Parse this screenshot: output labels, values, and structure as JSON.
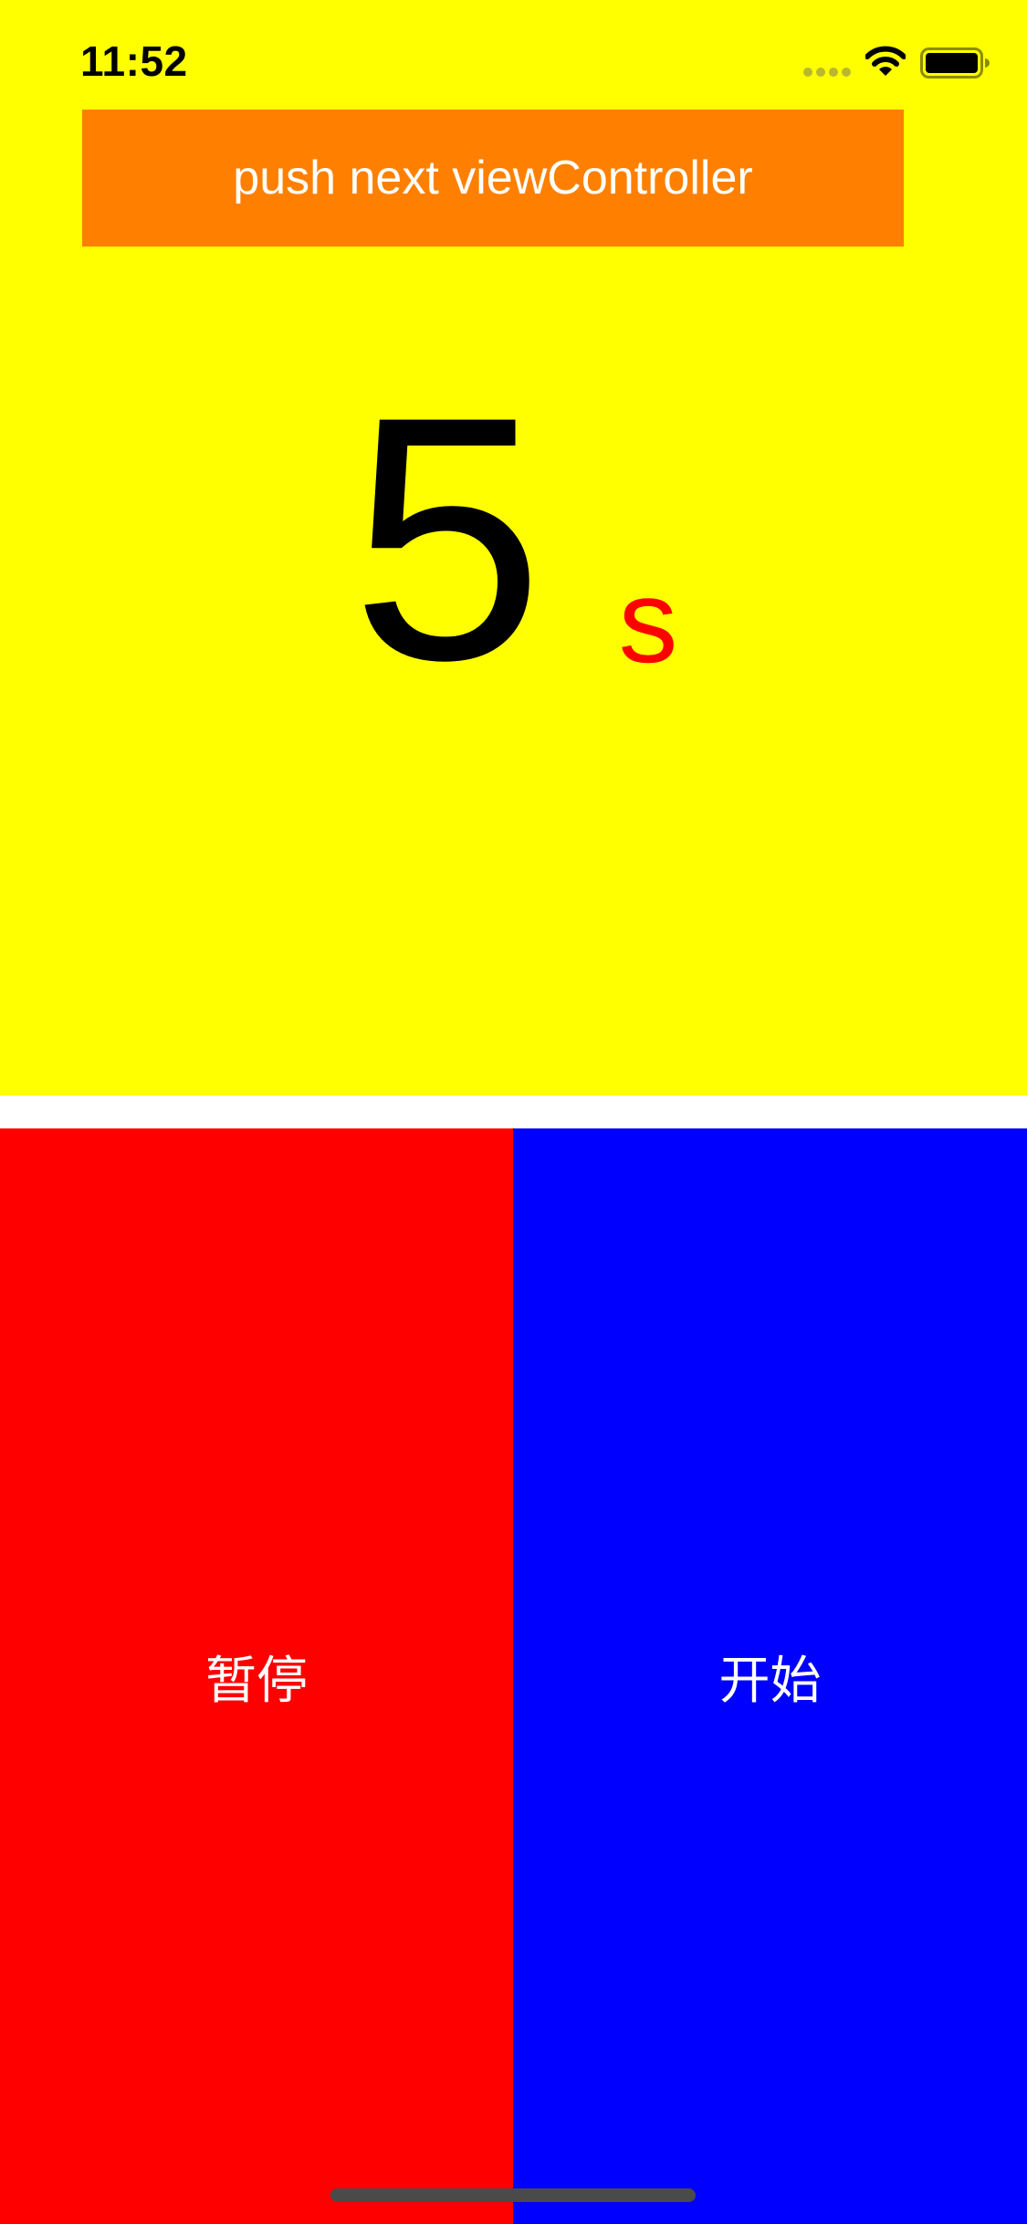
{
  "status_bar": {
    "time": "11:52",
    "signal_icon": "cellular-signal-icon",
    "wifi_icon": "wifi-icon",
    "battery_icon": "battery-icon"
  },
  "push_button": {
    "label": "push next viewController"
  },
  "countdown": {
    "value": "5",
    "unit": "s"
  },
  "controls": {
    "pause_label": "暂停",
    "start_label": "开始"
  },
  "colors": {
    "top_background": "#FFFF00",
    "push_button": "#FF8000",
    "countdown_number": "#000000",
    "countdown_unit": "#FF0000",
    "pause_button": "#FF0000",
    "start_button": "#0000FF",
    "button_text": "#FFFFFF"
  }
}
